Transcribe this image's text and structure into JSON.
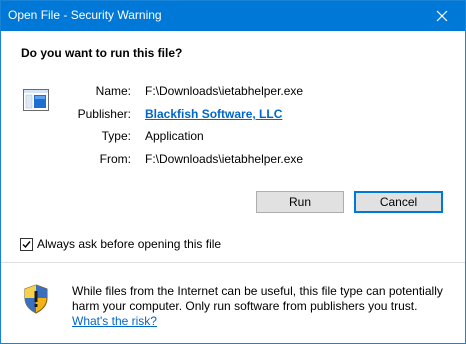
{
  "window": {
    "title": "Open File - Security Warning"
  },
  "prompt": {
    "question": "Do you want to run this file?"
  },
  "details": {
    "name_label": "Name:",
    "name_value": "F:\\Downloads\\ietabhelper.exe",
    "publisher_label": "Publisher:",
    "publisher_value": "Blackfish Software, LLC",
    "type_label": "Type:",
    "type_value": "Application",
    "from_label": "From:",
    "from_value": "F:\\Downloads\\ietabhelper.exe"
  },
  "buttons": {
    "run_label": "Run",
    "cancel_label": "Cancel"
  },
  "options": {
    "always_ask_label": "Always ask before opening this file",
    "always_ask_checked": true
  },
  "warning": {
    "line1": "While files from the Internet can be useful, this file type can potentially",
    "line2": "harm your computer. Only run software from publishers you trust.",
    "link_label": "What's the risk?"
  },
  "colors": {
    "titlebar": "#0078d7",
    "link": "#0066cc",
    "button_face": "#e1e1e1",
    "default_button_border": "#0078d7"
  },
  "icons": {
    "close": "close-icon",
    "file": "application-file-icon",
    "shield": "security-shield-icon",
    "check": "checkmark-icon"
  }
}
